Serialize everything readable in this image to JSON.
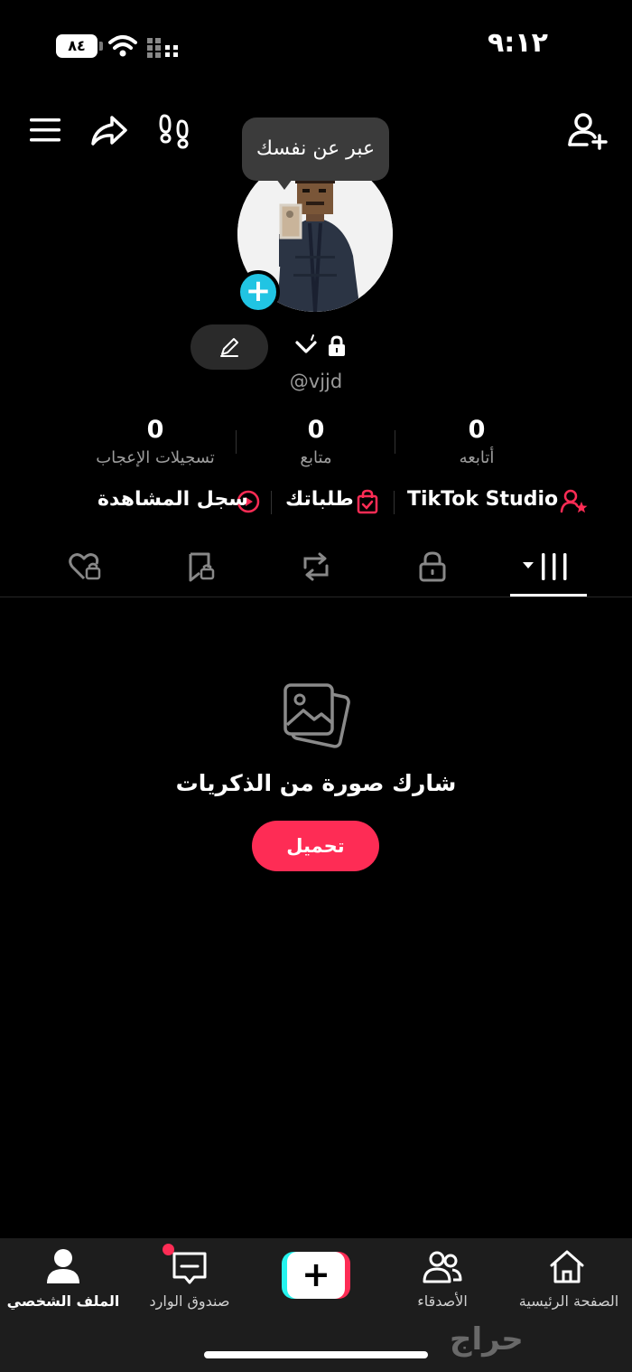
{
  "status_bar": {
    "time": "٩:١٢",
    "battery": "٨٤"
  },
  "tooltip": {
    "text": "عبر عن نفسك"
  },
  "profile": {
    "username": "@vjjd",
    "add_icon": "+"
  },
  "stats": [
    {
      "value": "0",
      "label": "أتابعه"
    },
    {
      "value": "0",
      "label": "متابع"
    },
    {
      "value": "0",
      "label": "تسجيلات الإعجاب"
    }
  ],
  "links": {
    "studio": "TikTok Studio",
    "orders": "طلباتك",
    "history": "سجل المشاهدة"
  },
  "tabs": [
    "videos-grid-icon",
    "lock-icon",
    "repost-icon",
    "saved-icon",
    "liked-icon"
  ],
  "empty_state": {
    "title": "شارك صورة من الذكريات",
    "button": "تحميل"
  },
  "bottom_nav": {
    "home": "الصفحة الرئيسية",
    "friends": "الأصدقاء",
    "create": "+",
    "inbox": "صندوق الوارد",
    "profile": "الملف الشخصي"
  },
  "watermark": "حراج",
  "colors": {
    "accent": "#fe2c55",
    "cyan": "#21c4e3",
    "background": "#000000"
  }
}
